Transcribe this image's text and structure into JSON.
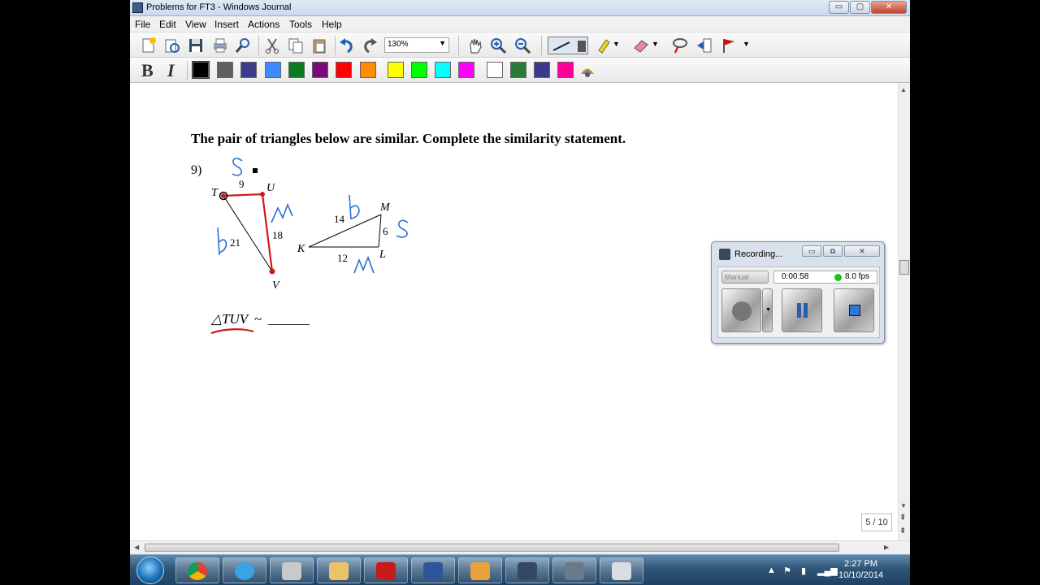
{
  "window": {
    "title": "Problems for FT3 - Windows Journal",
    "controls": {
      "minimize": "▭",
      "maximize": "▢",
      "close": "✕"
    }
  },
  "menu": [
    "File",
    "Edit",
    "View",
    "Insert",
    "Actions",
    "Tools",
    "Help"
  ],
  "toolbar": {
    "zoom_value": "130%",
    "format_buttons": {
      "bold": "B",
      "italic": "I"
    },
    "colors": [
      "#000000",
      "#606060",
      "#3c3c8c",
      "#3c8cff",
      "#0a7a1e",
      "#7a0a7a",
      "#ff0000",
      "#ff8c00",
      "#ffff00",
      "#00ff00",
      "#00ffff",
      "#ff00ff",
      "#ffffff",
      "#2a7a3a",
      "#3a3a8a",
      "#ff0099"
    ]
  },
  "document": {
    "question": "The pair of triangles below are similar. Complete the similarity statement.",
    "problem_number": "9)",
    "triangle1": {
      "vertices": [
        "T",
        "U",
        "V"
      ],
      "sides": [
        "9",
        "18",
        "21"
      ]
    },
    "triangle2": {
      "vertices": [
        "K",
        "L",
        "M"
      ],
      "sides": [
        "14",
        "6",
        "12"
      ]
    },
    "annotations": [
      "S",
      "M",
      "b",
      "b",
      "S",
      "M"
    ],
    "statement_left": "△TUV",
    "statement_sep": "~",
    "statement_blank": "______",
    "page_indicator": "5 / 10"
  },
  "recording": {
    "title": "Recording...",
    "mode": "Manual",
    "elapsed": "0:00:58",
    "fps": "8.0 fps",
    "window_controls": {
      "minimize": "▭",
      "restore": "⧉",
      "close": "✕"
    }
  },
  "taskbar": {
    "apps": [
      "chrome",
      "internet-explorer",
      "paint",
      "file-explorer",
      "adobe-reader",
      "word",
      "outlook",
      "camtasia",
      "camtasia-recorder",
      "calculator"
    ],
    "time": "2:27 PM",
    "date": "10/10/2014"
  }
}
